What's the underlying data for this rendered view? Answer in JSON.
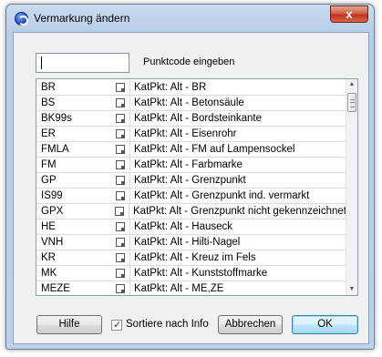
{
  "window": {
    "title": "Vermarkung ändern",
    "close_glyph": "x"
  },
  "input": {
    "value": "",
    "label": "Punktcode eingeben"
  },
  "list": {
    "rows": [
      {
        "code": "BR",
        "desc": "KatPkt: Alt - BR"
      },
      {
        "code": "BS",
        "desc": "KatPkt: Alt - Betonsäule"
      },
      {
        "code": "BK99s",
        "desc": "KatPkt: Alt - Bordsteinkante"
      },
      {
        "code": "ER",
        "desc": "KatPkt: Alt - Eisenrohr"
      },
      {
        "code": "FMLA",
        "desc": "KatPkt: Alt - FM auf Lampensockel"
      },
      {
        "code": "FM",
        "desc": "KatPkt: Alt - Farbmarke"
      },
      {
        "code": "GP",
        "desc": "KatPkt: Alt - Grenzpunkt"
      },
      {
        "code": "IS99",
        "desc": "KatPkt: Alt - Grenzpunkt ind. vermarkt"
      },
      {
        "code": "GPX",
        "desc": "KatPkt: Alt - Grenzpunkt nicht gekennzeichnet"
      },
      {
        "code": "HE",
        "desc": "KatPkt: Alt - Hauseck"
      },
      {
        "code": "VNH",
        "desc": "KatPkt: Alt - Hilti-Nagel"
      },
      {
        "code": "KR",
        "desc": "KatPkt: Alt - Kreuz im Fels"
      },
      {
        "code": "MK",
        "desc": "KatPkt: Alt - Kunststoffmarke"
      },
      {
        "code": "MEZE",
        "desc": "KatPkt: Alt - ME,ZE"
      }
    ]
  },
  "buttons": {
    "help": "Hilfe",
    "cancel": "Abbrechen",
    "ok": "OK"
  },
  "sort_checkbox": {
    "label": "Sortiere nach Info",
    "checked": true
  }
}
